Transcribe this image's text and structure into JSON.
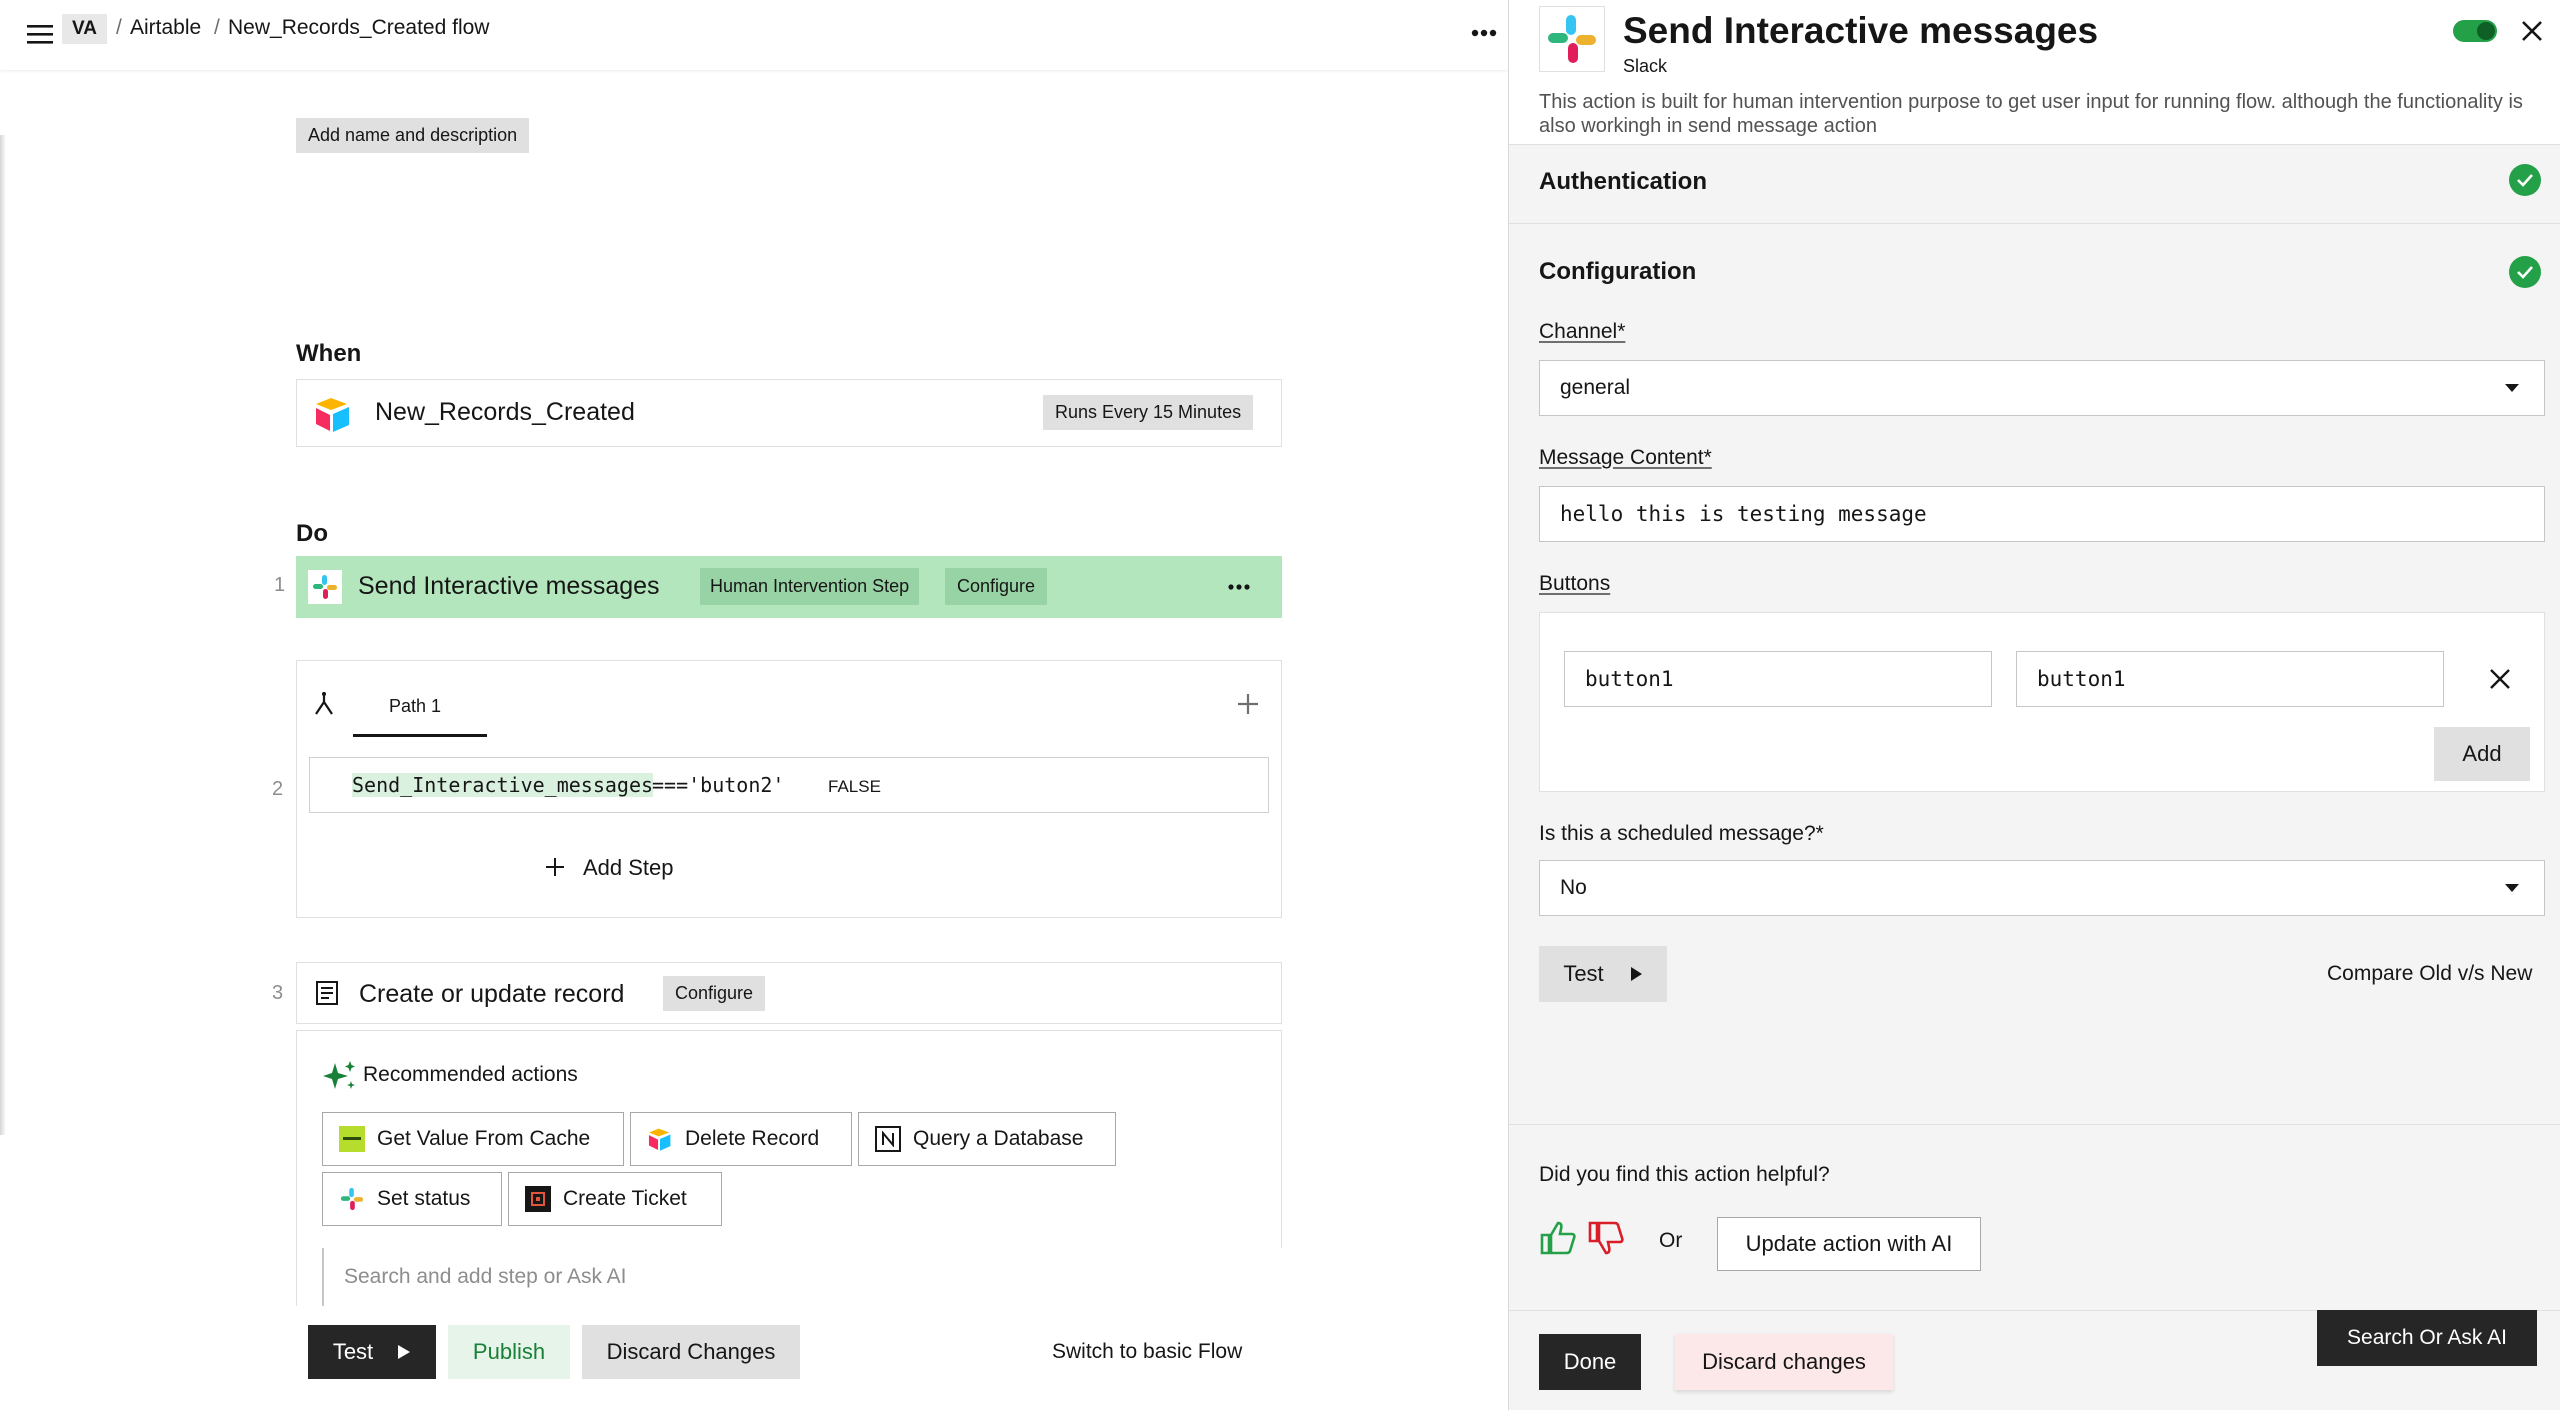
{
  "topbar": {
    "workspace": "VA",
    "sep1": "/",
    "app": "Airtable",
    "sep2": "/",
    "flow_name": "New_Records_Created flow"
  },
  "flow": {
    "add_name_label": "Add name and description",
    "when_label": "When",
    "trigger": {
      "name": "New_Records_Created",
      "schedule": "Runs Every 15 Minutes"
    },
    "do_label": "Do",
    "steps": [
      {
        "num": "1",
        "name": "Send Interactive messages",
        "tag": "Human Intervention Step",
        "configure": "Configure"
      },
      {
        "num": "2"
      },
      {
        "num": "3",
        "name": "Create or update record",
        "configure": "Configure"
      }
    ],
    "branch": {
      "path_tab": "Path 1",
      "condition_var": "Send_Interactive_messages",
      "condition_rest": "==='buton2'",
      "condition_result": "FALSE",
      "add_step": "Add Step"
    },
    "recommended": {
      "title": "Recommended actions",
      "actions": [
        "Get Value From Cache",
        "Delete Record",
        "Query a Database",
        "Set status",
        "Create Ticket"
      ]
    },
    "search_placeholder": "Search and add step or Ask AI"
  },
  "bottom_bar": {
    "test": "Test",
    "publish": "Publish",
    "discard": "Discard Changes",
    "switch": "Switch to basic Flow"
  },
  "panel": {
    "title": "Send Interactive messages",
    "app": "Slack",
    "description": "This action is built for human intervention purpose to get user input for running flow. although the functionality is also workingh in send message action",
    "authentication": "Authentication",
    "configuration": "Configuration",
    "channel_label": "Channel*",
    "channel_value": "general",
    "message_label": "Message Content*",
    "message_value": "hello this is testing message",
    "buttons_label": "Buttons",
    "button_row": [
      "button1",
      "button1"
    ],
    "add": "Add",
    "scheduled_label": "Is this a scheduled message?*",
    "scheduled_value": "No",
    "test": "Test",
    "compare": "Compare Old v/s New",
    "helpful_q": "Did you find this action helpful?",
    "or": "Or",
    "update_ai": "Update action with AI",
    "done": "Done",
    "discard": "Discard changes",
    "search_ai": "Search Or Ask AI"
  },
  "colors": {
    "step_highlight": "#b3e6bd",
    "success": "#24a148",
    "toggle": "#24a148",
    "publish_bg": "#e6f4ea",
    "publish_text": "#198038",
    "discard_bg": "#fce8e8",
    "dark_button": "#262626"
  }
}
